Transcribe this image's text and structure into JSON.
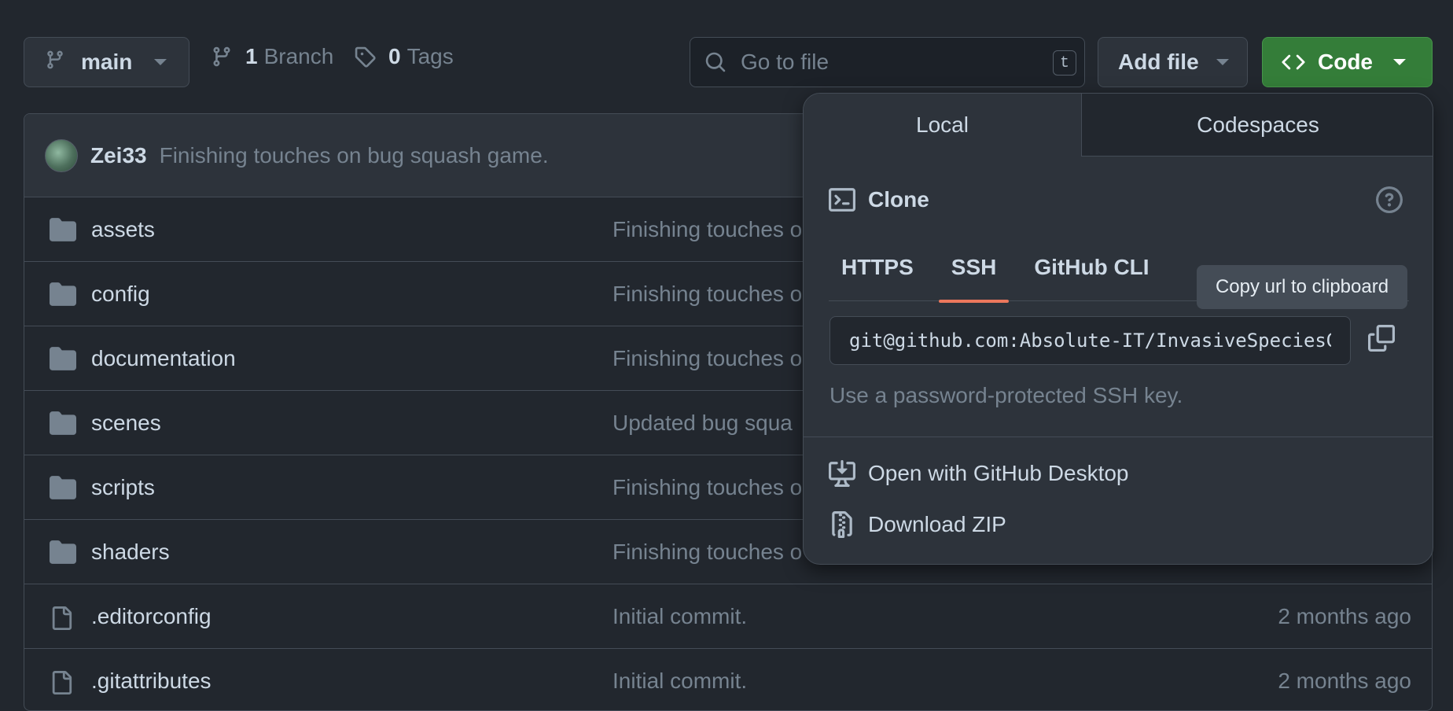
{
  "toolbar": {
    "branch": "main",
    "branches_count": "1",
    "branches_label": "Branch",
    "tags_count": "0",
    "tags_label": "Tags",
    "search_placeholder": "Go to file",
    "search_shortcut": "t",
    "add_file_label": "Add file",
    "code_label": "Code"
  },
  "latest_commit": {
    "author": "Zei33",
    "message": "Finishing touches on bug squash game."
  },
  "files": [
    {
      "name": "assets",
      "type": "folder",
      "message": "Finishing touches o",
      "date": ""
    },
    {
      "name": "config",
      "type": "folder",
      "message": "Finishing touches o",
      "date": ""
    },
    {
      "name": "documentation",
      "type": "folder",
      "message": "Finishing touches o",
      "date": ""
    },
    {
      "name": "scenes",
      "type": "folder",
      "message": "Updated bug squa",
      "date": ""
    },
    {
      "name": "scripts",
      "type": "folder",
      "message": "Finishing touches o",
      "date": ""
    },
    {
      "name": "shaders",
      "type": "folder",
      "message": "Finishing touches o",
      "date": ""
    },
    {
      "name": ".editorconfig",
      "type": "file",
      "message": "Initial commit.",
      "date": "2 months ago"
    },
    {
      "name": ".gitattributes",
      "type": "file",
      "message": "Initial commit.",
      "date": "2 months ago"
    }
  ],
  "code_dropdown": {
    "tabs": [
      "Local",
      "Codespaces"
    ],
    "clone_title": "Clone",
    "protocols": [
      "HTTPS",
      "SSH",
      "GitHub CLI"
    ],
    "active_protocol": "SSH",
    "clone_url": "git@github.com:Absolute-IT/InvasiveSpeciesGame.git",
    "tooltip": "Copy url to clipboard",
    "hint": "Use a password-protected SSH key.",
    "open_desktop_label": "Open with GitHub Desktop",
    "download_zip_label": "Download ZIP"
  },
  "colors": {
    "background": "#22272e",
    "code_button": "#347d39",
    "active_tab_underline": "#ec775c"
  }
}
